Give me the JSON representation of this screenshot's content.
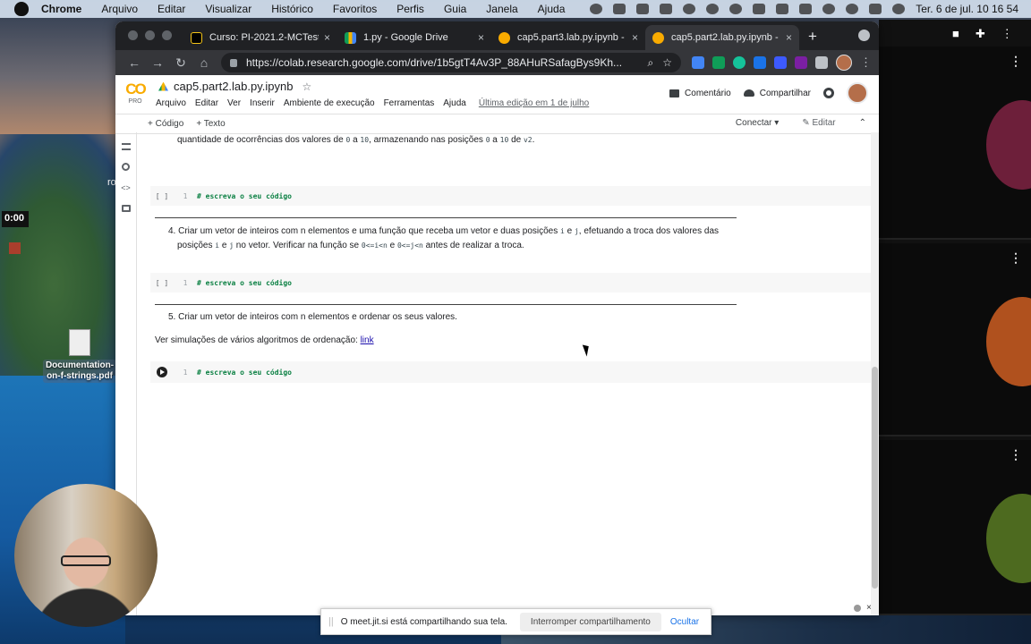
{
  "menubar": {
    "app": "Chrome",
    "items": [
      "Arquivo",
      "Editar",
      "Visualizar",
      "Histórico",
      "Favoritos",
      "Perfis",
      "Guia",
      "Janela",
      "Ajuda"
    ],
    "clock": "Ter. 6 de jul.  10 16 54"
  },
  "desktop": {
    "timer": "0:00",
    "letter": "ro",
    "file_name": "Documentation-on-f-strings.pdf"
  },
  "browser": {
    "tabs": [
      {
        "title": "Curso: PI-2021.2-MCTest",
        "close": "×",
        "favicon_color": "#000000"
      },
      {
        "title": "1.py - Google Drive",
        "close": "×",
        "favicon_color": "#0f9d58"
      },
      {
        "title": "cap5.part3.lab.py.ipynb -",
        "close": "×",
        "favicon_color": "#f9ab00"
      },
      {
        "title": "cap5.part2.lab.py.ipynb -",
        "close": "×",
        "favicon_color": "#f9ab00",
        "active": true
      }
    ],
    "new_tab": "+",
    "url_host": "https://colab.research.google.com",
    "url_path": "/drive/1b5gtT4Av3P_88AHuRSafagBys9Kh..."
  },
  "colab": {
    "logo": "CO",
    "logo_sub": "PRO",
    "notebook_title": "cap5.part2.lab.py.ipynb",
    "menu": [
      "Arquivo",
      "Editar",
      "Ver",
      "Inserir",
      "Ambiente de execução",
      "Ferramentas",
      "Ajuda"
    ],
    "last_edit": "Última edição em 1 de julho",
    "comment_label": "Comentário",
    "share_label": "Compartilhar",
    "add_code": "+ Código",
    "add_text": "+ Texto",
    "connect": "Conectar",
    "edit": "Editar"
  },
  "cells": {
    "text1_a": "quantidade de ocorrências dos valores de ",
    "text1_code1": "0",
    "text1_b": " a ",
    "text1_code2": "10",
    "text1_c": ", armazenando nas posições ",
    "text1_code3": "0",
    "text1_d": " a ",
    "text1_code4": "10",
    "text1_e": " de ",
    "text1_code5": "v2",
    "text1_f": ".",
    "code_prompt": "[ ]",
    "line_no": "1",
    "code_comment": "# escreva o seu código",
    "item4_num": "4.",
    "item4_a": "Criar um vetor de inteiros com n elementos e uma função que receba um vetor e duas posições ",
    "item4_code_i": "i",
    "item4_b": " e ",
    "item4_code_j": "j",
    "item4_c": ", efetuando a troca dos valores das",
    "item4_d": "posições ",
    "item4_code_i2": "i",
    "item4_e": " e ",
    "item4_code_j2": "j",
    "item4_f": " no vetor. Verificar na função se ",
    "item4_code_cond1": "0<=i<n",
    "item4_g": " e ",
    "item4_code_cond2": "0<=j<n",
    "item4_h": " antes de realizar a troca.",
    "item5_num": "5.",
    "item5_text": "Criar um vetor de inteiros com n elementos e ordenar os seus valores.",
    "sim_text": "Ver simulações de vários algoritmos de ordenação: ",
    "sim_link": "link"
  },
  "share_banner": {
    "grip": "||",
    "message": "O meet.jit.si está compartilhando sua tela.",
    "stop": "Interromper compartilhamento",
    "hide": "Ocultar"
  },
  "bottom": {
    "close": "×"
  },
  "right_panel": {
    "kebab": "⋮"
  }
}
